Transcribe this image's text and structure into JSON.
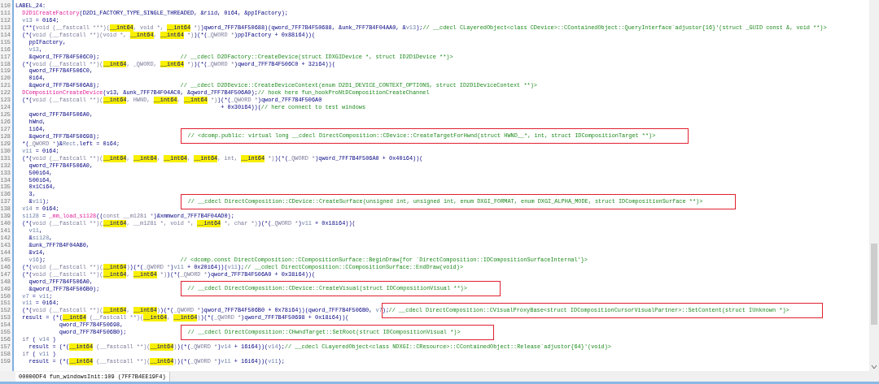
{
  "editor": {
    "lines": [
      {
        "number": "110",
        "tokens": [
          {
            "kind": "code",
            "text": "LABEL_24:"
          }
        ]
      },
      {
        "number": "111",
        "tokens": [
          {
            "kind": "func",
            "text": "  D2D1CreateFactory"
          },
          {
            "kind": "code",
            "text": "(D2D1_FACTORY_TYPE_SINGLE_THREADED, &riid, 0i64, &ppIFactory);"
          }
        ]
      },
      {
        "number": "112",
        "tokens": [
          {
            "kind": "var",
            "text": "  v13"
          },
          {
            "kind": "code",
            "text": " = 0i64;"
          }
        ]
      },
      {
        "number": "113",
        "tokens": [
          {
            "kind": "code",
            "text": "  (**("
          },
          {
            "kind": "kw",
            "text": "void (__fastcall ***)("
          },
          {
            "kind": "hl",
            "text": "__int64"
          },
          {
            "kind": "kw",
            "text": ", void *, "
          },
          {
            "kind": "hl",
            "text": "__int64"
          },
          {
            "kind": "kw",
            "text": " *)"
          },
          {
            "kind": "code",
            "text": ")qword_7FF7B4F50688)(qword_7FF7B4F50688, &unk_7FF7B4F04AA0, &"
          },
          {
            "kind": "var",
            "text": "v13"
          },
          {
            "kind": "code",
            "text": ");"
          },
          {
            "kind": "comment",
            "boxed": false,
            "text": "// __cdecl CLayeredObject<class CDevice>::CContainedObject::QueryInterface`adjustor{16}'(struct _GUID const &, void **)>"
          }
        ]
      },
      {
        "number": "114",
        "tokens": [
          {
            "kind": "code",
            "text": "  (*("
          },
          {
            "kind": "kw",
            "text": "void (__fastcall **)(void *, "
          },
          {
            "kind": "hl",
            "text": "__int64"
          },
          {
            "kind": "kw",
            "text": ", "
          },
          {
            "kind": "hl",
            "text": "__int64"
          },
          {
            "kind": "kw",
            "text": " *)"
          },
          {
            "kind": "code",
            "text": ")(*("
          },
          {
            "kind": "kw",
            "text": "_QWORD *"
          },
          {
            "kind": "code",
            "text": ")ppIFactory + 0x88i64))("
          }
        ]
      },
      {
        "number": "115",
        "tokens": [
          {
            "kind": "code",
            "text": "    ppIFactory,"
          }
        ]
      },
      {
        "number": "116",
        "tokens": [
          {
            "kind": "var",
            "text": "    v13"
          },
          {
            "kind": "code",
            "text": ","
          }
        ]
      },
      {
        "number": "117",
        "tokens": [
          {
            "kind": "code",
            "text": "    &qword_7FF7B4F506C0);"
          },
          {
            "kind": "tab_comment",
            "boxed": false,
            "text": "// __cdecl D2DFactory::CreateDevice(struct IDXGIDevice *, struct ID2D1Device **)>"
          }
        ]
      },
      {
        "number": "118",
        "tokens": [
          {
            "kind": "code",
            "text": "  (*("
          },
          {
            "kind": "kw",
            "text": "void (__fastcall **)("
          },
          {
            "kind": "hl",
            "text": "__int64"
          },
          {
            "kind": "kw",
            "text": ", _QWORD, "
          },
          {
            "kind": "hl",
            "text": "__int64"
          },
          {
            "kind": "kw",
            "text": " *)"
          },
          {
            "kind": "code",
            "text": ")(*("
          },
          {
            "kind": "kw",
            "text": "_QWORD *"
          },
          {
            "kind": "code",
            "text": ")qword_7FF7B4F506C0 + 32i64))("
          }
        ]
      },
      {
        "number": "119",
        "tokens": [
          {
            "kind": "code",
            "text": "    qword_7FF7B4F506C0,"
          }
        ]
      },
      {
        "number": "120",
        "tokens": [
          {
            "kind": "code",
            "text": "    0i64,"
          }
        ]
      },
      {
        "number": "121",
        "tokens": [
          {
            "kind": "code",
            "text": "    &qword_7FF7B4F506A8);"
          },
          {
            "kind": "tab_comment",
            "boxed": false,
            "text": "// __cdecl D2DDevice::CreateDeviceContext(enum D2D1_DEVICE_CONTEXT_OPTIONS, struct ID2D1DeviceContext **)>"
          }
        ]
      },
      {
        "number": "122",
        "tokens": [
          {
            "kind": "func",
            "text": "  DCompositionCreateDevice"
          },
          {
            "kind": "code",
            "text": "(v13, &unk_7FF7B4F04AC0, &qword_7FF7B4F506A0);"
          },
          {
            "kind": "comment",
            "boxed": false,
            "text": "// hook here fun_hookProNtDCompositionCreateChannel"
          }
        ]
      },
      {
        "number": "123",
        "tokens": [
          {
            "kind": "code",
            "text": "  (*("
          },
          {
            "kind": "kw",
            "text": "void (__fastcall **)("
          },
          {
            "kind": "hl",
            "text": "__int64"
          },
          {
            "kind": "kw",
            "text": ", HWND, "
          },
          {
            "kind": "hl",
            "text": "__int64"
          },
          {
            "kind": "kw",
            "text": ", "
          },
          {
            "kind": "hl",
            "text": "__int64"
          },
          {
            "kind": "kw",
            "text": " *)"
          },
          {
            "kind": "code",
            "text": ")(*("
          },
          {
            "kind": "kw",
            "text": "_QWORD *"
          },
          {
            "kind": "code",
            "text": ")qword_7FF7B4F506A0"
          }
        ]
      },
      {
        "number": "124",
        "tokens": [
          {
            "kind": "code",
            "text": "                                                             + 0x30i64))("
          },
          {
            "kind": "comment",
            "boxed": false,
            "text": "// here connect to test windows"
          }
        ]
      },
      {
        "number": "125",
        "tokens": [
          {
            "kind": "code",
            "text": "    qword_7FF7B4F506A0,"
          }
        ]
      },
      {
        "number": "126",
        "tokens": [
          {
            "kind": "code",
            "text": "    hWnd,"
          }
        ]
      },
      {
        "number": "127",
        "tokens": [
          {
            "kind": "code",
            "text": "    1i64,"
          }
        ]
      },
      {
        "number": "128",
        "tokens": [
          {
            "kind": "code",
            "text": "    &qword_7FF7B4F50698);"
          },
          {
            "kind": "tab_comment",
            "boxed": true,
            "text": "// <dcomp.public: virtual long __cdecl DirectComposition::CDevice::CreateTargetForHwnd(struct HWND__*, int, struct IDCompositionTarget **)>"
          }
        ]
      },
      {
        "number": "129",
        "tokens": [
          {
            "kind": "code",
            "text": "  *("
          },
          {
            "kind": "kw",
            "text": "_QWORD *"
          },
          {
            "kind": "code",
            "text": ")&"
          },
          {
            "kind": "var",
            "text": "Rect"
          },
          {
            "kind": "code",
            "text": ".left = 0i64;"
          }
        ]
      },
      {
        "number": "130",
        "tokens": [
          {
            "kind": "var",
            "text": "  v11"
          },
          {
            "kind": "code",
            "text": " = 0i64;"
          }
        ]
      },
      {
        "number": "131",
        "tokens": [
          {
            "kind": "code",
            "text": "  (*("
          },
          {
            "kind": "kw",
            "text": "void (__fastcall **)("
          },
          {
            "kind": "hl",
            "text": "__int64"
          },
          {
            "kind": "kw",
            "text": ", "
          },
          {
            "kind": "hl",
            "text": "__int64"
          },
          {
            "kind": "kw",
            "text": ", "
          },
          {
            "kind": "hl",
            "text": "__int64"
          },
          {
            "kind": "kw",
            "text": ", "
          },
          {
            "kind": "hl",
            "text": "__int64"
          },
          {
            "kind": "kw",
            "text": ", int, "
          },
          {
            "kind": "hl",
            "text": "__int64"
          },
          {
            "kind": "kw",
            "text": " *)"
          },
          {
            "kind": "code",
            "text": ")(*("
          },
          {
            "kind": "kw",
            "text": "_QWORD *"
          },
          {
            "kind": "code",
            "text": ")qword_7FF7B4F506A0 + 0x40i64))("
          }
        ]
      },
      {
        "number": "132",
        "tokens": [
          {
            "kind": "code",
            "text": "    qword_7FF7B4F506A0,"
          }
        ]
      },
      {
        "number": "133",
        "tokens": [
          {
            "kind": "code",
            "text": "    500i64,"
          }
        ]
      },
      {
        "number": "134",
        "tokens": [
          {
            "kind": "code",
            "text": "    500i64,"
          }
        ]
      },
      {
        "number": "135",
        "tokens": [
          {
            "kind": "code",
            "text": "    0x1Ci64,"
          }
        ]
      },
      {
        "number": "136",
        "tokens": [
          {
            "kind": "code",
            "text": "    3,"
          }
        ]
      },
      {
        "number": "137",
        "tokens": [
          {
            "kind": "code",
            "text": "    &"
          },
          {
            "kind": "var",
            "text": "v11"
          },
          {
            "kind": "code",
            "text": ");"
          },
          {
            "kind": "tab_comment",
            "boxed": true,
            "text": "// __cdecl DirectComposition::CDevice::CreateSurface(unsigned int, unsigned int, enum DXGI_FORMAT, enum DXGI_ALPHA_MODE, struct IDCompositionSurface **)>"
          }
        ]
      },
      {
        "number": "138",
        "tokens": [
          {
            "kind": "var",
            "text": "  v14"
          },
          {
            "kind": "code",
            "text": " = 0i64;"
          }
        ]
      },
      {
        "number": "139",
        "tokens": [
          {
            "kind": "var",
            "text": "  si128"
          },
          {
            "kind": "code",
            "text": " = "
          },
          {
            "kind": "func",
            "text": "_mm_load_si128"
          },
          {
            "kind": "code",
            "text": "(("
          },
          {
            "kind": "kw",
            "text": "const __m128i *"
          },
          {
            "kind": "code",
            "text": ")&xmmword_7FF7B4F04AD0);"
          }
        ]
      },
      {
        "number": "140",
        "tokens": [
          {
            "kind": "code",
            "text": "  (*("
          },
          {
            "kind": "kw",
            "text": "void (__fastcall **)("
          },
          {
            "kind": "hl",
            "text": "__int64"
          },
          {
            "kind": "kw",
            "text": ", __m128i *, void *, "
          },
          {
            "kind": "hl",
            "text": "__int64"
          },
          {
            "kind": "kw",
            "text": " *, char *)"
          },
          {
            "kind": "code",
            "text": ")(*("
          },
          {
            "kind": "kw",
            "text": "_QWORD *"
          },
          {
            "kind": "code",
            "text": ")"
          },
          {
            "kind": "var",
            "text": "v11"
          },
          {
            "kind": "code",
            "text": " + 0x18i64))("
          }
        ]
      },
      {
        "number": "141",
        "tokens": [
          {
            "kind": "var",
            "text": "    v11"
          },
          {
            "kind": "code",
            "text": ","
          }
        ]
      },
      {
        "number": "142",
        "tokens": [
          {
            "kind": "code",
            "text": "    &"
          },
          {
            "kind": "var",
            "text": "si128"
          },
          {
            "kind": "code",
            "text": ","
          }
        ]
      },
      {
        "number": "143",
        "tokens": [
          {
            "kind": "code",
            "text": "    &unk_7FF7B4F04AB0,"
          }
        ]
      },
      {
        "number": "144",
        "tokens": [
          {
            "kind": "code",
            "text": "    &v14,"
          }
        ]
      },
      {
        "number": "145",
        "tokens": [
          {
            "kind": "var",
            "text": "    v16"
          },
          {
            "kind": "code",
            "text": ");"
          },
          {
            "kind": "tab_comment",
            "boxed": false,
            "text": "// <dcomp.const DirectComposition::CCompositionSurface::BeginDraw{for `DirectComposition::IDCompositionSurfaceInternal'}>"
          }
        ]
      },
      {
        "number": "146",
        "tokens": [
          {
            "kind": "code",
            "text": "  (*("
          },
          {
            "kind": "kw",
            "text": "void (__fastcall **)("
          },
          {
            "kind": "hl",
            "text": "__int64"
          },
          {
            "kind": "kw",
            "text": ")"
          },
          {
            "kind": "code",
            "text": ")(*("
          },
          {
            "kind": "kw",
            "text": "_QWORD *"
          },
          {
            "kind": "code",
            "text": ")"
          },
          {
            "kind": "var",
            "text": "v11"
          },
          {
            "kind": "code",
            "text": " + 0x20i64))("
          },
          {
            "kind": "var",
            "text": "v11"
          },
          {
            "kind": "code",
            "text": ");"
          },
          {
            "kind": "comment",
            "boxed": false,
            "text": "// __cdecl DirectComposition::CCompositionSurface::EndDraw(void)>"
          }
        ]
      },
      {
        "number": "147",
        "tokens": [
          {
            "kind": "code",
            "text": "  (*("
          },
          {
            "kind": "kw",
            "text": "void (__fastcall **)("
          },
          {
            "kind": "hl",
            "text": "__int64"
          },
          {
            "kind": "kw",
            "text": ", "
          },
          {
            "kind": "hl",
            "text": "__int64"
          },
          {
            "kind": "kw",
            "text": " *)"
          },
          {
            "kind": "code",
            "text": ")(*("
          },
          {
            "kind": "kw",
            "text": "_QWORD *"
          },
          {
            "kind": "code",
            "text": ")qword_7FF7B4F506A0 + 0x38i64))("
          }
        ]
      },
      {
        "number": "148",
        "tokens": [
          {
            "kind": "code",
            "text": "    qword_7FF7B4F506A0,"
          }
        ]
      },
      {
        "number": "149",
        "tokens": [
          {
            "kind": "code",
            "text": "    &qword_7FF7B4F506B0);"
          },
          {
            "kind": "tab_comment",
            "boxed": true,
            "text": "// __cdecl DirectComposition::CDevice::CreateVisual(struct IDCompositionVisual **)>"
          }
        ]
      },
      {
        "number": "150",
        "tokens": [
          {
            "kind": "var",
            "text": "  v7"
          },
          {
            "kind": "code",
            "text": " = "
          },
          {
            "kind": "var",
            "text": "v11"
          },
          {
            "kind": "code",
            "text": ";"
          }
        ]
      },
      {
        "number": "151",
        "tokens": [
          {
            "kind": "var",
            "text": "  v11"
          },
          {
            "kind": "code",
            "text": " = 0i64;"
          }
        ]
      },
      {
        "number": "152",
        "tokens": [
          {
            "kind": "code",
            "text": "  (*("
          },
          {
            "kind": "kw",
            "text": "void (__fastcall **)("
          },
          {
            "kind": "hl",
            "text": "__int64"
          },
          {
            "kind": "kw",
            "text": ", "
          },
          {
            "kind": "hl",
            "text": "__int64"
          },
          {
            "kind": "kw",
            "text": ")"
          },
          {
            "kind": "code",
            "text": ")(*("
          },
          {
            "kind": "kw",
            "text": "_QWORD *"
          },
          {
            "kind": "code",
            "text": ")qword_7FF7B4F506B0 + 0x78i64))(qword_7FF7B4F506B0, "
          },
          {
            "kind": "var",
            "text": "v7"
          },
          {
            "kind": "code",
            "text": ");"
          },
          {
            "kind": "comment",
            "boxed": true,
            "text": "// __cdecl DirectComposition::CVisualProxyBase<struct IDCompositionCursorVisualPartner>::SetContent(struct IUnknown *)>"
          }
        ]
      },
      {
        "number": "153",
        "tokens": [
          {
            "kind": "code",
            "text": "  result = (*("
          },
          {
            "kind": "hl",
            "text": "__int64"
          },
          {
            "kind": "kw",
            "text": " (__fastcall **)("
          },
          {
            "kind": "hl",
            "text": "__int64"
          },
          {
            "kind": "kw",
            "text": ", "
          },
          {
            "kind": "hl",
            "text": "__int64"
          },
          {
            "kind": "kw",
            "text": ")"
          },
          {
            "kind": "code",
            "text": ")(*("
          },
          {
            "kind": "kw",
            "text": "_QWORD *"
          },
          {
            "kind": "code",
            "text": ")qword_7FF7B4F50698 + 0x18i64))("
          }
        ]
      },
      {
        "number": "154",
        "tokens": [
          {
            "kind": "code",
            "text": "             qword_7FF7B4F50698,"
          }
        ]
      },
      {
        "number": "155",
        "tokens": [
          {
            "kind": "code",
            "text": "             qword_7FF7B4F506B0);"
          },
          {
            "kind": "tab_comment",
            "boxed": true,
            "text": "// __cdecl DirectComposition::CHwndTarget::SetRoot(struct IDCompositionVisual *)>"
          }
        ]
      },
      {
        "number": "156",
        "tokens": [
          {
            "kind": "kw",
            "text": "  if"
          },
          {
            "kind": "code",
            "text": " ( "
          },
          {
            "kind": "var",
            "text": "v14"
          },
          {
            "kind": "code",
            "text": " )"
          }
        ]
      },
      {
        "number": "157",
        "tokens": [
          {
            "kind": "code",
            "text": "    result = (*("
          },
          {
            "kind": "hl",
            "text": "__int64"
          },
          {
            "kind": "kw",
            "text": " (__fastcall **)("
          },
          {
            "kind": "hl",
            "text": "__int64"
          },
          {
            "kind": "kw",
            "text": ")"
          },
          {
            "kind": "code",
            "text": ")(*("
          },
          {
            "kind": "kw",
            "text": "_QWORD *"
          },
          {
            "kind": "code",
            "text": ")"
          },
          {
            "kind": "var",
            "text": "v14"
          },
          {
            "kind": "code",
            "text": " + 16i64))("
          },
          {
            "kind": "var",
            "text": "v14"
          },
          {
            "kind": "code",
            "text": ");"
          },
          {
            "kind": "comment",
            "boxed": false,
            "text": "// __cdecl CLayeredObject<class NDXGI::CResource>::CContainedObject::Release`adjustor{64}'(void)>"
          }
        ]
      },
      {
        "number": "158",
        "tokens": [
          {
            "kind": "kw",
            "text": "  if"
          },
          {
            "kind": "code",
            "text": " ( "
          },
          {
            "kind": "var",
            "text": "v11"
          },
          {
            "kind": "code",
            "text": " )"
          }
        ]
      },
      {
        "number": "159",
        "tokens": [
          {
            "kind": "code",
            "text": "    result = (*("
          },
          {
            "kind": "hl",
            "text": "__int64"
          },
          {
            "kind": "kw",
            "text": " (__fastcall **)("
          },
          {
            "kind": "hl",
            "text": "__int64"
          },
          {
            "kind": "kw",
            "text": ")"
          },
          {
            "kind": "code",
            "text": ")(*("
          },
          {
            "kind": "kw",
            "text": "_QWORD *"
          },
          {
            "kind": "code",
            "text": ")"
          },
          {
            "kind": "var",
            "text": "v11"
          },
          {
            "kind": "code",
            "text": " + 16i64))("
          },
          {
            "kind": "var",
            "text": "v11"
          },
          {
            "kind": "code",
            "text": ");"
          }
        ]
      }
    ]
  },
  "status_bar": {
    "text": "00000DF4 fun_windowsInit:109 (7FF7B4EE19F4)"
  }
}
